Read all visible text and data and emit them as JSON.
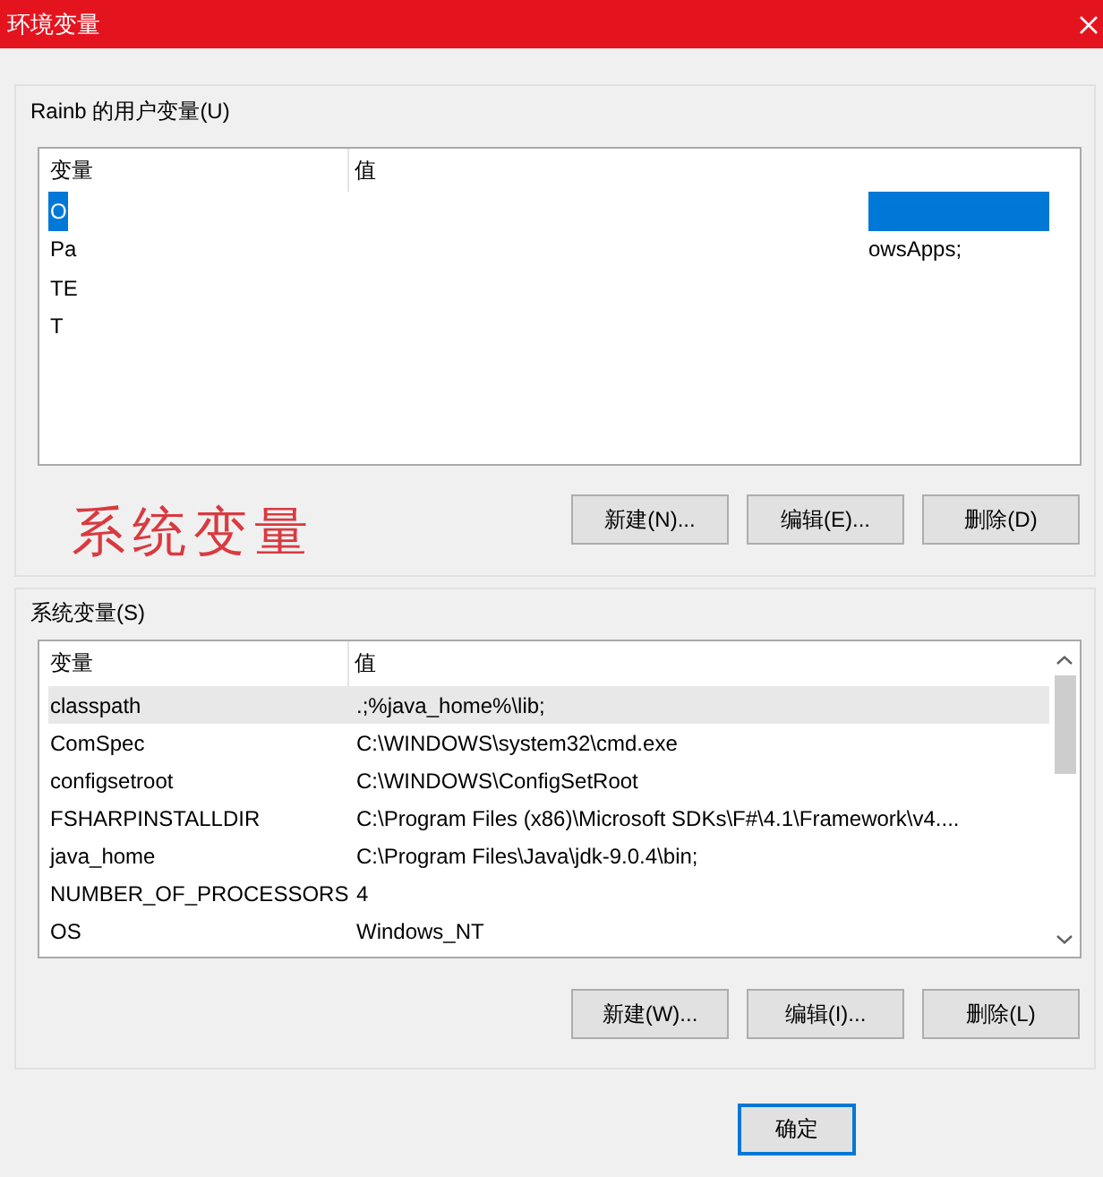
{
  "window": {
    "title": "环境变量"
  },
  "user_vars": {
    "label": "Rainb 的用户变量(U)",
    "columns": [
      "变量",
      "值"
    ],
    "rows": [
      {
        "name": "O",
        "selected": true
      },
      {
        "name": "Pa",
        "value": "owsApps;",
        "selected": false
      },
      {
        "name": "TE",
        "selected": false
      },
      {
        "name": "T",
        "selected": false
      }
    ],
    "buttons": [
      "新建(N)...",
      "编辑(E)...",
      "删除(D)"
    ]
  },
  "annotation": "系统变量",
  "system_vars": {
    "label": "系统变量(S)",
    "columns": [
      "变量",
      "值"
    ],
    "rows": [
      {
        "name": "classpath",
        "value": ".;%java_home%\\lib;",
        "selected": true
      },
      {
        "name": "ComSpec",
        "value": "C:\\WINDOWS\\system32\\cmd.exe",
        "selected": false
      },
      {
        "name": "configsetroot",
        "value": "C:\\WINDOWS\\ConfigSetRoot",
        "selected": false
      },
      {
        "name": "FSHARPINSTALLDIR",
        "value": "C:\\Program Files (x86)\\Microsoft SDKs\\F#\\4.1\\Framework\\v4....",
        "selected": false
      },
      {
        "name": "java_home",
        "value": "C:\\Program Files\\Java\\jdk-9.0.4\\bin;",
        "selected": false
      },
      {
        "name": "NUMBER_OF_PROCESSORS",
        "value": "4",
        "selected": false
      },
      {
        "name": "OS",
        "value": "Windows_NT",
        "selected": false
      }
    ],
    "buttons": [
      "新建(W)...",
      "编辑(I)...",
      "删除(L)"
    ]
  },
  "dialog_buttons": [
    {
      "label": "确定",
      "default": true
    }
  ]
}
